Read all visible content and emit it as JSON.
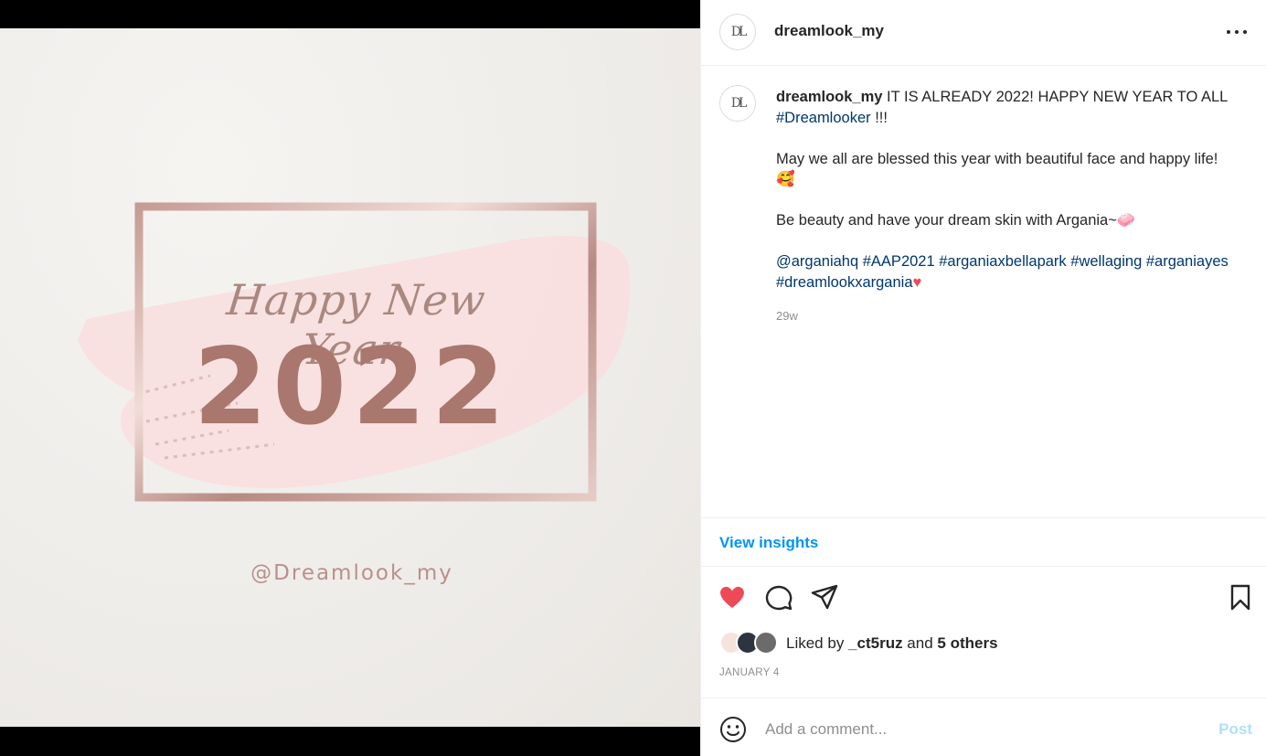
{
  "post": {
    "image": {
      "greeting": "Happy New Year",
      "year": "2022",
      "handle": "@Dreamlook_my",
      "colors": {
        "rose_gold": "#b78a82",
        "pink_brush": "#f8dedf",
        "paper": "#efedea"
      }
    },
    "header": {
      "username": "dreamlook_my",
      "avatar_icon": "dreamlook-logo-icon",
      "more_icon": "more-options-icon"
    },
    "caption": {
      "username": "dreamlook_my",
      "line1": " IT IS ALREADY 2022! HAPPY NEW YEAR TO ALL ",
      "tag_dreamlooker": "#Dreamlooker",
      "line1_end": " !!!",
      "para2": "May we all are blessed this year with beautiful face and happy life!🥰",
      "para3": "Be beauty and have your dream skin with Argania~🧼",
      "tags": [
        "@arganiahq",
        "#AAP2021",
        "#arganiaxbellapark",
        "#wellaging",
        "#arganiayes",
        "#dreamlookxargania"
      ],
      "end_emoji": "♥",
      "time_ago": "29w"
    },
    "insights_label": "View insights",
    "actions": {
      "like_icon": "heart-filled-icon",
      "comment_icon": "comment-icon",
      "share_icon": "share-icon",
      "save_icon": "bookmark-icon",
      "liked_color": "#ed4956"
    },
    "likes": {
      "prefix": "Liked by ",
      "user": "_ct5ruz",
      "middle": " and ",
      "others": "5 others"
    },
    "date": "JANUARY 4",
    "comment": {
      "placeholder": "Add a comment...",
      "post_label": "Post",
      "emoji_icon": "smiley-icon"
    }
  }
}
